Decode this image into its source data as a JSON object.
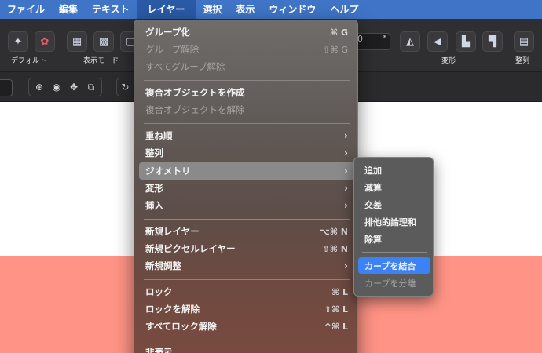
{
  "menubar": {
    "items": [
      {
        "label": "ファイル"
      },
      {
        "label": "編集"
      },
      {
        "label": "テキスト"
      },
      {
        "label": "レイヤー",
        "active": true
      },
      {
        "label": "選択"
      },
      {
        "label": "表示"
      },
      {
        "label": "ウィンドウ"
      },
      {
        "label": "ヘルプ"
      }
    ]
  },
  "toolbar": {
    "default_label": "デフォルト",
    "view_mode_label": "表示モード",
    "transform_label": "変形",
    "align_label": "整列",
    "field_star": "*",
    "field_value": "0"
  },
  "layer_menu": {
    "items": [
      {
        "label": "グループ化",
        "shortcut": "⌘ G",
        "enabled": true
      },
      {
        "label": "グループ解除",
        "shortcut": "⇧⌘ G",
        "enabled": false
      },
      {
        "label": "すべてグループ解除",
        "shortcut": "",
        "enabled": false
      },
      {
        "label": "複合オブジェクトを作成",
        "shortcut": "",
        "enabled": true
      },
      {
        "label": "複合オブジェクトを解除",
        "shortcut": "",
        "enabled": false
      },
      {
        "label": "重ね順",
        "submenu": true,
        "enabled": true
      },
      {
        "label": "整列",
        "submenu": true,
        "enabled": true
      },
      {
        "label": "ジオメトリ",
        "submenu": true,
        "enabled": true,
        "highlighted": true
      },
      {
        "label": "変形",
        "submenu": true,
        "enabled": true
      },
      {
        "label": "挿入",
        "submenu": true,
        "enabled": true
      },
      {
        "label": "新規レイヤー",
        "shortcut": "⌥⌘ N",
        "enabled": true
      },
      {
        "label": "新規ピクセルレイヤー",
        "shortcut": "⇧⌘ N",
        "enabled": true
      },
      {
        "label": "新規調整",
        "submenu": true,
        "enabled": true
      },
      {
        "label": "ロック",
        "shortcut": "⌘ L",
        "enabled": true
      },
      {
        "label": "ロックを解除",
        "shortcut": "⇧⌘ L",
        "enabled": true
      },
      {
        "label": "すべてロック解除",
        "shortcut": "^⌘ L",
        "enabled": true
      },
      {
        "label": "非表示",
        "shortcut": "",
        "enabled": true
      }
    ]
  },
  "geometry_submenu": {
    "items": [
      {
        "label": "追加",
        "enabled": true
      },
      {
        "label": "減算",
        "enabled": true
      },
      {
        "label": "交差",
        "enabled": true
      },
      {
        "label": "排他的論理和",
        "enabled": true
      },
      {
        "label": "除算",
        "enabled": true
      },
      {
        "label": "カーブを結合",
        "enabled": true,
        "selected": true
      },
      {
        "label": "カーブを分離",
        "enabled": false
      }
    ]
  },
  "colors": {
    "menubar": "#3f74c6",
    "selection": "#3b82f6",
    "canvas_top": "#ffffff",
    "canvas_bottom": "#ff9486"
  }
}
